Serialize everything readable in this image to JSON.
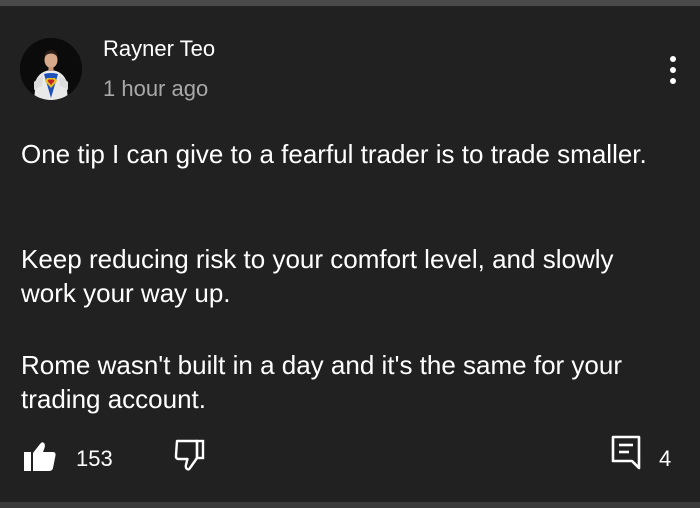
{
  "comment": {
    "author": "Rayner Teo",
    "timestamp": "1 hour ago",
    "paragraphs": [
      "One tip I can give to a fearful trader is to trade smaller.",
      "Keep reducing risk to your comfort level, and slowly work your way up.",
      "Rome wasn't built in a day and it's the same for your trading account."
    ]
  },
  "actions": {
    "like_count": "153",
    "reply_count": "4"
  },
  "icons": {
    "avatar": "avatar-icon",
    "menu": "more-vertical-icon",
    "like": "thumbs-up-icon",
    "dislike": "thumbs-down-icon",
    "reply": "comment-icon"
  },
  "colors": {
    "background": "#212121",
    "text": "#ffffff",
    "secondary_text": "#a9a9a9"
  }
}
